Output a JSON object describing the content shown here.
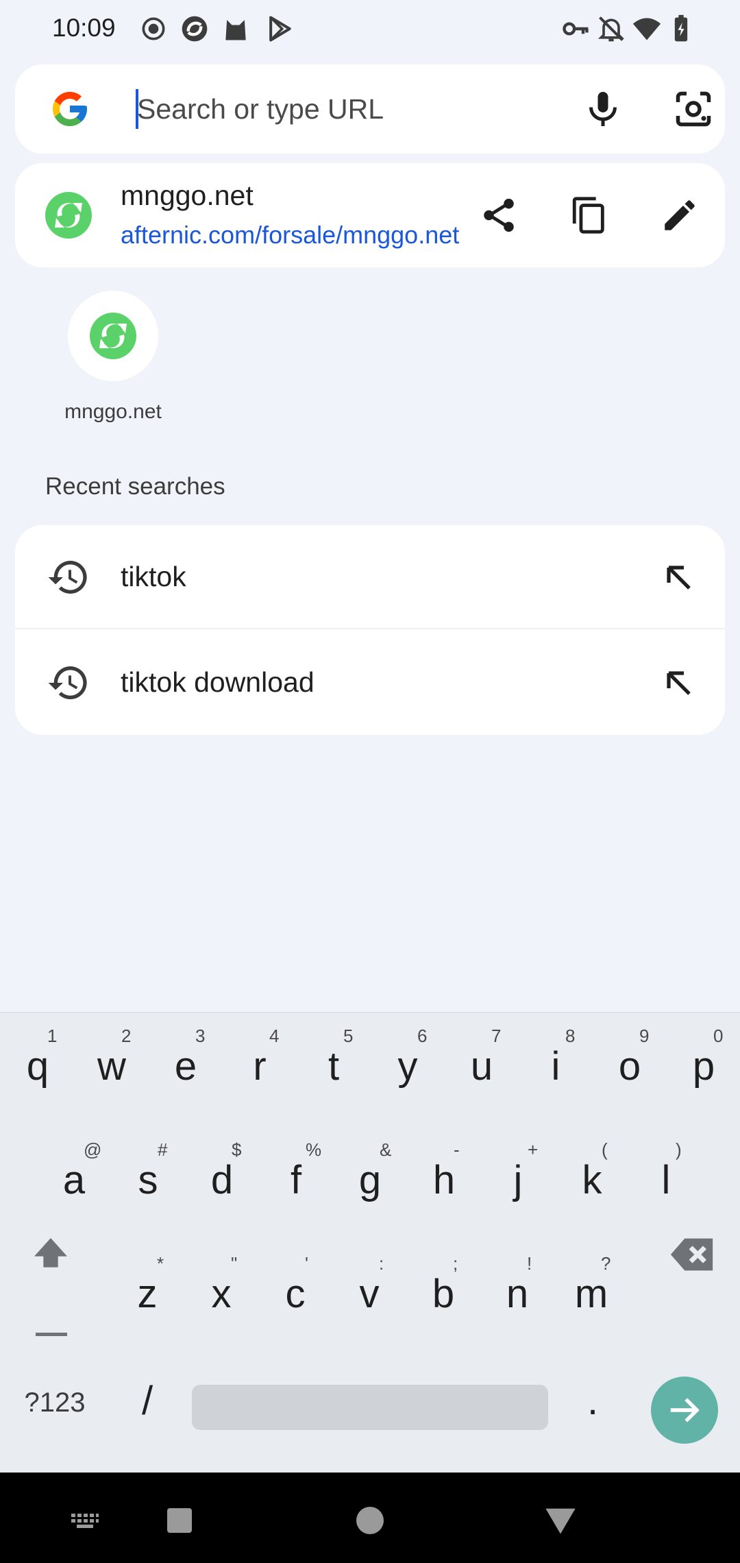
{
  "status_bar": {
    "time": "10:09",
    "left_icons": [
      "record-icon",
      "browser-app-icon",
      "cat-app-icon",
      "play-store-icon"
    ],
    "right_icons": [
      "vpn-key-icon",
      "notifications-off-icon",
      "wifi-icon",
      "battery-charging-icon"
    ]
  },
  "omnibox": {
    "placeholder": "Search or type URL",
    "value": "",
    "mic_icon": "mic-icon",
    "lens_icon": "lens-camera-icon"
  },
  "current_page": {
    "title": "mnggo.net",
    "url": "afternic.com/forsale/mnggo.net",
    "actions": [
      "share-icon",
      "copy-icon",
      "edit-icon"
    ]
  },
  "tiles": [
    {
      "label": "mnggo.net"
    }
  ],
  "recent": {
    "title": "Recent searches",
    "items": [
      {
        "text": "tiktok"
      },
      {
        "text": "tiktok download"
      }
    ]
  },
  "keyboard": {
    "row1": [
      {
        "k": "q",
        "h": "1"
      },
      {
        "k": "w",
        "h": "2"
      },
      {
        "k": "e",
        "h": "3"
      },
      {
        "k": "r",
        "h": "4"
      },
      {
        "k": "t",
        "h": "5"
      },
      {
        "k": "y",
        "h": "6"
      },
      {
        "k": "u",
        "h": "7"
      },
      {
        "k": "i",
        "h": "8"
      },
      {
        "k": "o",
        "h": "9"
      },
      {
        "k": "p",
        "h": "0"
      }
    ],
    "row2": [
      {
        "k": "a",
        "h": "@"
      },
      {
        "k": "s",
        "h": "#"
      },
      {
        "k": "d",
        "h": "$"
      },
      {
        "k": "f",
        "h": "%"
      },
      {
        "k": "g",
        "h": "&"
      },
      {
        "k": "h",
        "h": "-"
      },
      {
        "k": "j",
        "h": "+"
      },
      {
        "k": "k",
        "h": "("
      },
      {
        "k": "l",
        "h": ")"
      }
    ],
    "row3": [
      {
        "k": "z",
        "h": "*"
      },
      {
        "k": "x",
        "h": "\""
      },
      {
        "k": "c",
        "h": "'"
      },
      {
        "k": "v",
        "h": ":"
      },
      {
        "k": "b",
        "h": ";"
      },
      {
        "k": "n",
        "h": "!"
      },
      {
        "k": "m",
        "h": "?"
      }
    ],
    "symbols_label": "?123",
    "slash_label": "/",
    "period_label": ".",
    "accent_color": "#60b3a6"
  },
  "nav_bar": {
    "buttons": [
      "keyboard-switch-icon",
      "recents-icon",
      "home-icon",
      "back-icon"
    ]
  }
}
